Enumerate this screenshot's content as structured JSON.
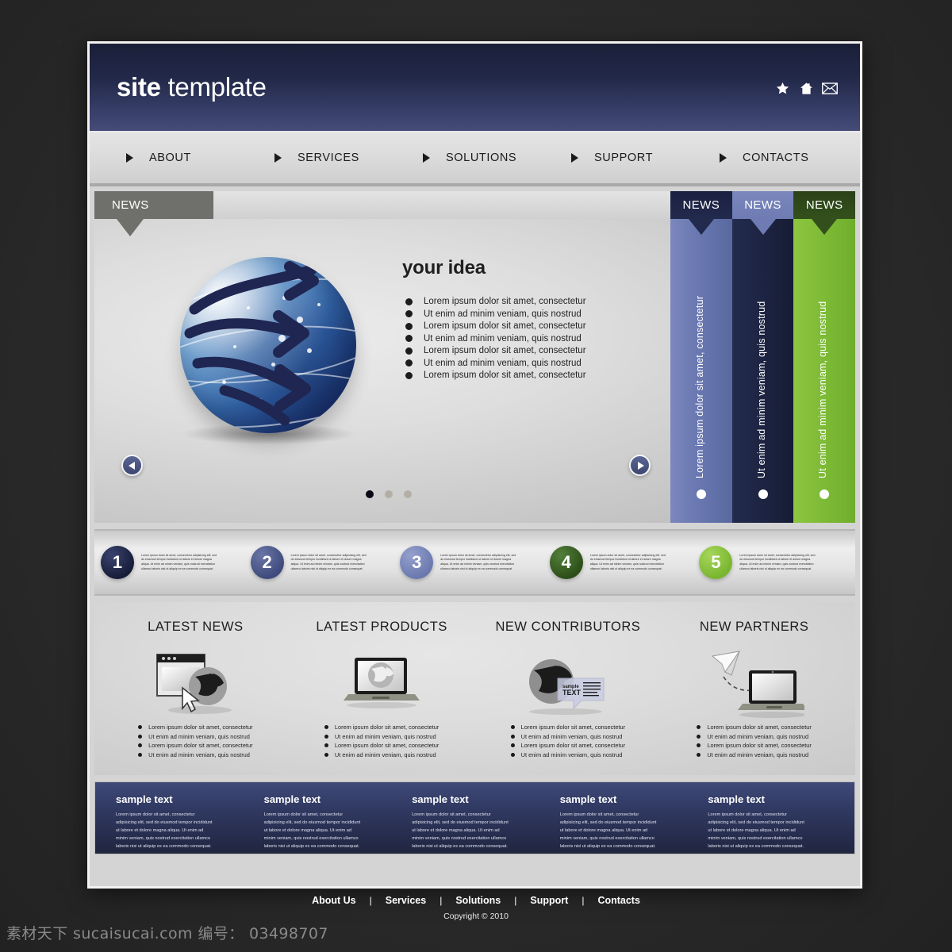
{
  "window": {
    "title": "site template"
  },
  "header": {
    "logo_bold": "site",
    "logo_light": " template",
    "icons": [
      {
        "name": "star-icon",
        "glyph": "★"
      },
      {
        "name": "home-icon",
        "glyph": "⌂"
      },
      {
        "name": "mail-icon",
        "glyph": "✉"
      }
    ],
    "brand_color": "#222949"
  },
  "nav": {
    "items": [
      {
        "label": "ABOUT"
      },
      {
        "label": "SERVICES"
      },
      {
        "label": "SOLUTIONS"
      },
      {
        "label": "SUPPORT"
      },
      {
        "label": "CONTACTS"
      }
    ]
  },
  "slider": {
    "tab_label": "NEWS",
    "title": "your idea",
    "bullets": [
      "Lorem ipsum dolor sit amet, consectetur",
      "Ut enim ad minim veniam, quis nostrud",
      "Lorem ipsum dolor sit amet, consectetur",
      "Ut enim ad minim veniam, quis nostrud",
      "Lorem ipsum dolor sit amet, consectetur",
      "Ut enim ad minim veniam, quis nostrud",
      "Lorem ipsum dolor sit amet, consectetur"
    ],
    "prev_label": "◀",
    "next_label": "▶",
    "dots": [
      {
        "active": true
      },
      {
        "active": false
      },
      {
        "active": false
      }
    ],
    "active_dot_index": 0,
    "total_slides": 3
  },
  "news_columns": [
    {
      "tab_label": "NEWS",
      "text": "Lorem ipsum dolor sit amet, consectetur",
      "tab_color": "#222a4d",
      "body_color": "#6b79b2"
    },
    {
      "tab_label": "NEWS",
      "text": "Ut enim ad minim veniam, quis nostrud",
      "tab_color": "#6e7cb3",
      "body_color": "#1d2442"
    },
    {
      "tab_label": "NEWS",
      "text": "Ut enim ad minim veniam, quis nostrud",
      "tab_color": "#33501c",
      "body_color": "#7dba36"
    }
  ],
  "steps": [
    {
      "number": "1",
      "color": "#1d2445",
      "text": "Lorem ipsum dolor sit amet, consectetur adipisicing elit, sed do eiusmod tempor incididunt ut labore et dolore magna aliqua. Ut enim ad minim veniam, quis nostrud exercitation ullamco laboris nisi ut aliquip ex ea commodo consequat."
    },
    {
      "number": "2",
      "color": "#4e5a8b",
      "text": "Lorem ipsum dolor sit amet, consectetur adipisicing elit, sed do eiusmod tempor incididunt ut labore et dolore magna aliqua. Ut enim ad minim veniam, quis nostrud exercitation ullamco laboris nisi ut aliquip ex ea commodo consequat."
    },
    {
      "number": "3",
      "color": "#7d8abf",
      "text": "Lorem ipsum dolor sit amet, consectetur adipisicing elit, sed do eiusmod tempor incididunt ut labore et dolore magna aliqua. Ut enim ad minim veniam, quis nostrud exercitation ullamco laboris nisi ut aliquip ex ea commodo consequat."
    },
    {
      "number": "4",
      "color": "#3d6322",
      "text": "Lorem ipsum dolor sit amet, consectetur adipisicing elit, sed do eiusmod tempor incididunt ut labore et dolore magna aliqua. Ut enim ad minim veniam, quis nostrud exercitation ullamco laboris nisi ut aliquip ex ea commodo consequat."
    },
    {
      "number": "5",
      "color": "#8cc63e",
      "text": "Lorem ipsum dolor sit amet, consectetur adipisicing elit, sed do eiusmod tempor incididunt ut labore et dolore magna aliqua. Ut enim ad minim veniam, quis nostrud exercitation ullamco laboris nisi ut aliquip ex ea commodo consequat."
    }
  ],
  "feature_columns": [
    {
      "title": "LATEST NEWS",
      "icon": "browser-globe-cursor-icon",
      "bullets": [
        "Lorem ipsum dolor sit amet, consectetur",
        "Ut enim ad minim veniam, quis nostrud",
        "Lorem ipsum dolor sit amet, consectetur",
        "Ut enim ad minim veniam, quis nostrud"
      ]
    },
    {
      "title": "LATEST PRODUCTS",
      "icon": "laptop-globe-icon",
      "bullets": [
        "Lorem ipsum dolor sit amet, consectetur",
        "Ut enim ad minim veniam, quis nostrud",
        "Lorem ipsum dolor sit amet, consectetur",
        "Ut enim ad minim veniam, quis nostrud"
      ]
    },
    {
      "title": "NEW CONTRIBUTORS",
      "icon": "globe-speech-bubble-icon",
      "icon_text": "sample TEXT",
      "bullets": [
        "Lorem ipsum dolor sit amet, consectetur",
        "Ut enim ad minim veniam, quis nostrud",
        "Lorem ipsum dolor sit amet, consectetur",
        "Ut enim ad minim veniam, quis nostrud"
      ]
    },
    {
      "title": "NEW PARTNERS",
      "icon": "paper-plane-laptop-icon",
      "bullets": [
        "Lorem ipsum dolor sit amet, consectetur",
        "Ut enim ad minim veniam, quis nostrud",
        "Lorem ipsum dolor sit amet, consectetur",
        "Ut enim ad minim veniam, quis nostrud"
      ]
    }
  ],
  "sample_blocks": [
    {
      "title": "sample text",
      "body": "Lorem ipsum dolor sit amet, consectetur adipisicing elit, sed do eiusmod tempor incididunt ut labore et dolore magna aliqua. Ut enim ad minim veniam, quis nostrud exercitation ullamco laboris nisi ut aliquip ex ea commodo consequat."
    },
    {
      "title": "sample text",
      "body": "Lorem ipsum dolor sit amet, consectetur adipisicing elit, sed do eiusmod tempor incididunt ut labore et dolore magna aliqua. Ut enim ad minim veniam, quis nostrud exercitation ullamco laboris nisi ut aliquip ex ea commodo consequat."
    },
    {
      "title": "sample text",
      "body": "Lorem ipsum dolor sit amet, consectetur adipisicing elit, sed do eiusmod tempor incididunt ut labore et dolore magna aliqua. Ut enim ad minim veniam, quis nostrud exercitation ullamco laboris nisi ut aliquip ex ea commodo consequat."
    },
    {
      "title": "sample text",
      "body": "Lorem ipsum dolor sit amet, consectetur adipisicing elit, sed do eiusmod tempor incididunt ut labore et dolore magna aliqua. Ut enim ad minim veniam, quis nostrud exercitation ullamco laboris nisi ut aliquip ex ea commodo consequat."
    },
    {
      "title": "sample text",
      "body": "Lorem ipsum dolor sit amet, consectetur adipisicing elit, sed do eiusmod tempor incididunt ut labore et dolore magna aliqua. Ut enim ad minim veniam, quis nostrud exercitation ullamco laboris nisi ut aliquip ex ea commodo consequat."
    }
  ],
  "footer": {
    "links": [
      "About Us",
      "Services",
      "Solutions",
      "Support",
      "Contacts"
    ],
    "separator": "|",
    "copyright": "Copyright © 2010"
  },
  "watermark": {
    "text": "素材天下 sucaisucai.com  编号： 03498707"
  }
}
